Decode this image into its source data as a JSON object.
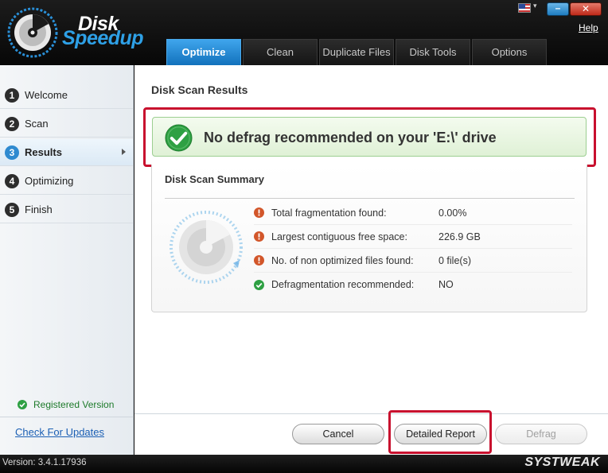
{
  "app": {
    "brand_line1": "Disk",
    "brand_line2": "Speedup",
    "help": "Help",
    "colors": {
      "accent": "#1e86d6",
      "success": "#2ea043",
      "warning": "#d2562a",
      "highlight": "#c8102e"
    }
  },
  "window_controls": {
    "minimize": "–",
    "close": "✕",
    "flag": "us-flag-icon"
  },
  "tabs": [
    {
      "label": "Optimize",
      "active": true
    },
    {
      "label": "Clean"
    },
    {
      "label": "Duplicate Files"
    },
    {
      "label": "Disk Tools"
    },
    {
      "label": "Options"
    }
  ],
  "sidebar": {
    "items": [
      {
        "num": "1",
        "label": "Welcome"
      },
      {
        "num": "2",
        "label": "Scan"
      },
      {
        "num": "3",
        "label": "Results",
        "active": true
      },
      {
        "num": "4",
        "label": "Optimizing"
      },
      {
        "num": "5",
        "label": "Finish"
      }
    ],
    "registered": "Registered Version",
    "check_updates": "Check For Updates"
  },
  "main": {
    "title": "Disk Scan Results",
    "result_message": "No defrag recommended on your 'E:\\' drive",
    "summary_title": "Disk Scan Summary",
    "rows": [
      {
        "icon": "warning-icon",
        "label": "Total fragmentation found:",
        "value": "0.00%"
      },
      {
        "icon": "warning-icon",
        "label": "Largest contiguous free space:",
        "value": "226.9 GB"
      },
      {
        "icon": "warning-icon",
        "label": "No. of non optimized files found:",
        "value": "0 file(s)"
      },
      {
        "icon": "check-icon",
        "label": "Defragmentation recommended:",
        "value": "NO"
      }
    ],
    "buttons": {
      "cancel": "Cancel",
      "report": "Detailed Report",
      "defrag": "Defrag"
    }
  },
  "footer": {
    "version": "Version: 3.4.1.17936",
    "company": "SYSTWEAK"
  }
}
